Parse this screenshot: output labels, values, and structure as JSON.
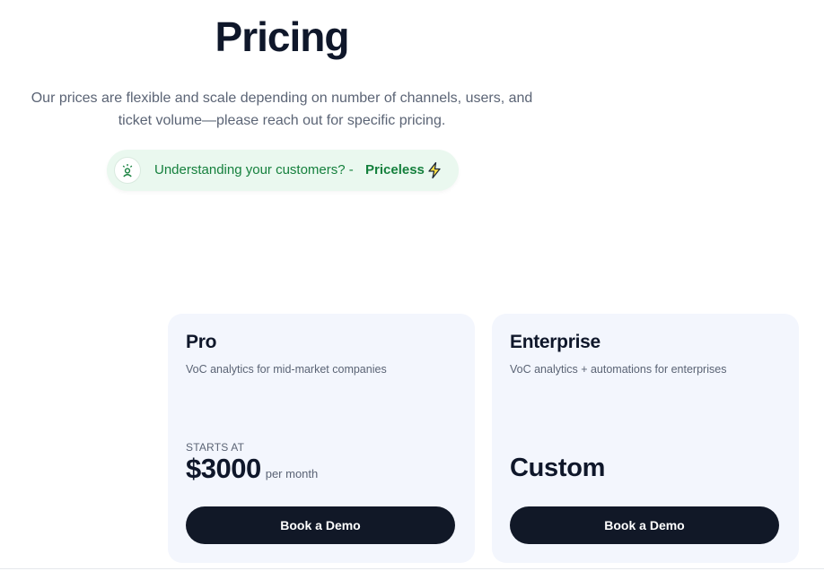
{
  "header": {
    "title": "Pricing",
    "subtitle_line1": "Our prices are flexible and scale depending on number of channels, users, and",
    "subtitle_line2": "ticket volume—please reach out for specific pricing."
  },
  "banner": {
    "text": "Understanding your customers? -",
    "highlight": "Priceless",
    "icon": "person-idea-icon",
    "trailing_icon": "lightning-bolt-icon",
    "accent_color": "#15803d",
    "background_color": "#eaf8ef"
  },
  "plans": [
    {
      "name": "Pro",
      "description": "VoC analytics for mid-market companies",
      "price_prefix": "STARTS AT",
      "price": "$3000",
      "price_suffix": "per month",
      "cta_label": "Book a Demo"
    },
    {
      "name": "Enterprise",
      "description": "VoC analytics + automations for enterprises",
      "price": "Custom",
      "cta_label": "Book a Demo"
    }
  ],
  "colors": {
    "card_background": "#f3f6fd",
    "button_background": "#111827",
    "heading": "#0f172a",
    "muted_text": "#5b6475"
  }
}
